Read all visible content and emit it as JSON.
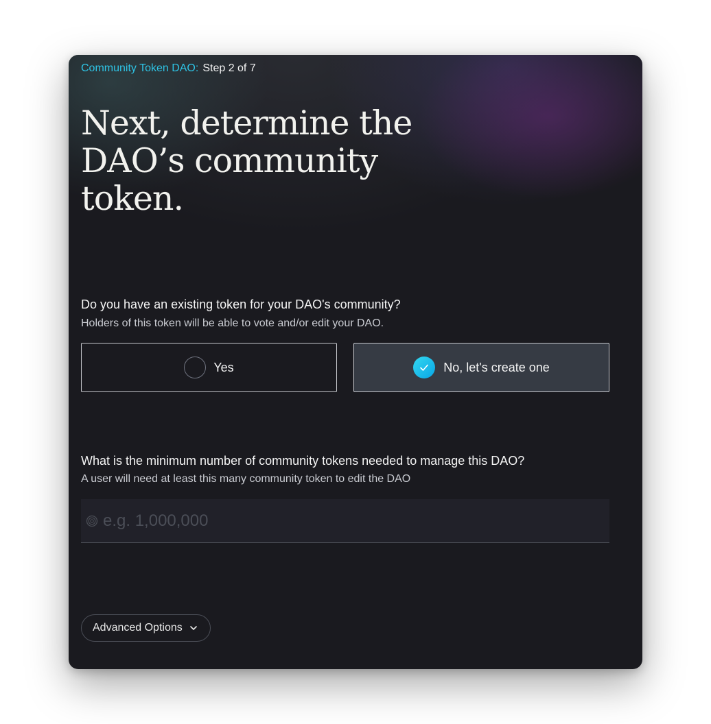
{
  "breadcrumb": {
    "dao_type": "Community Token DAO:",
    "step": "Step 2 of 7"
  },
  "title": "Next, determine the DAO’s community token.",
  "question1": {
    "title": "Do you have an existing token for your DAO's community?",
    "subtitle": "Holders of this token will be able to vote and/or edit your DAO.",
    "options": [
      {
        "label": "Yes",
        "selected": false
      },
      {
        "label": "No, let's create one",
        "selected": true
      }
    ]
  },
  "question2": {
    "title": "What is the minimum number of community tokens needed to manage this DAO?",
    "subtitle": "A user will need at least this many community token to edit the DAO",
    "input": {
      "value": "",
      "placeholder": "e.g. 1,000,000",
      "icon": "token-icon"
    }
  },
  "advanced": {
    "label": "Advanced Options",
    "icon": "chevron-down-icon"
  },
  "colors": {
    "accent": "#2ec4e6",
    "background": "#1a1a1f",
    "selected_option_bg": "#363b44"
  }
}
